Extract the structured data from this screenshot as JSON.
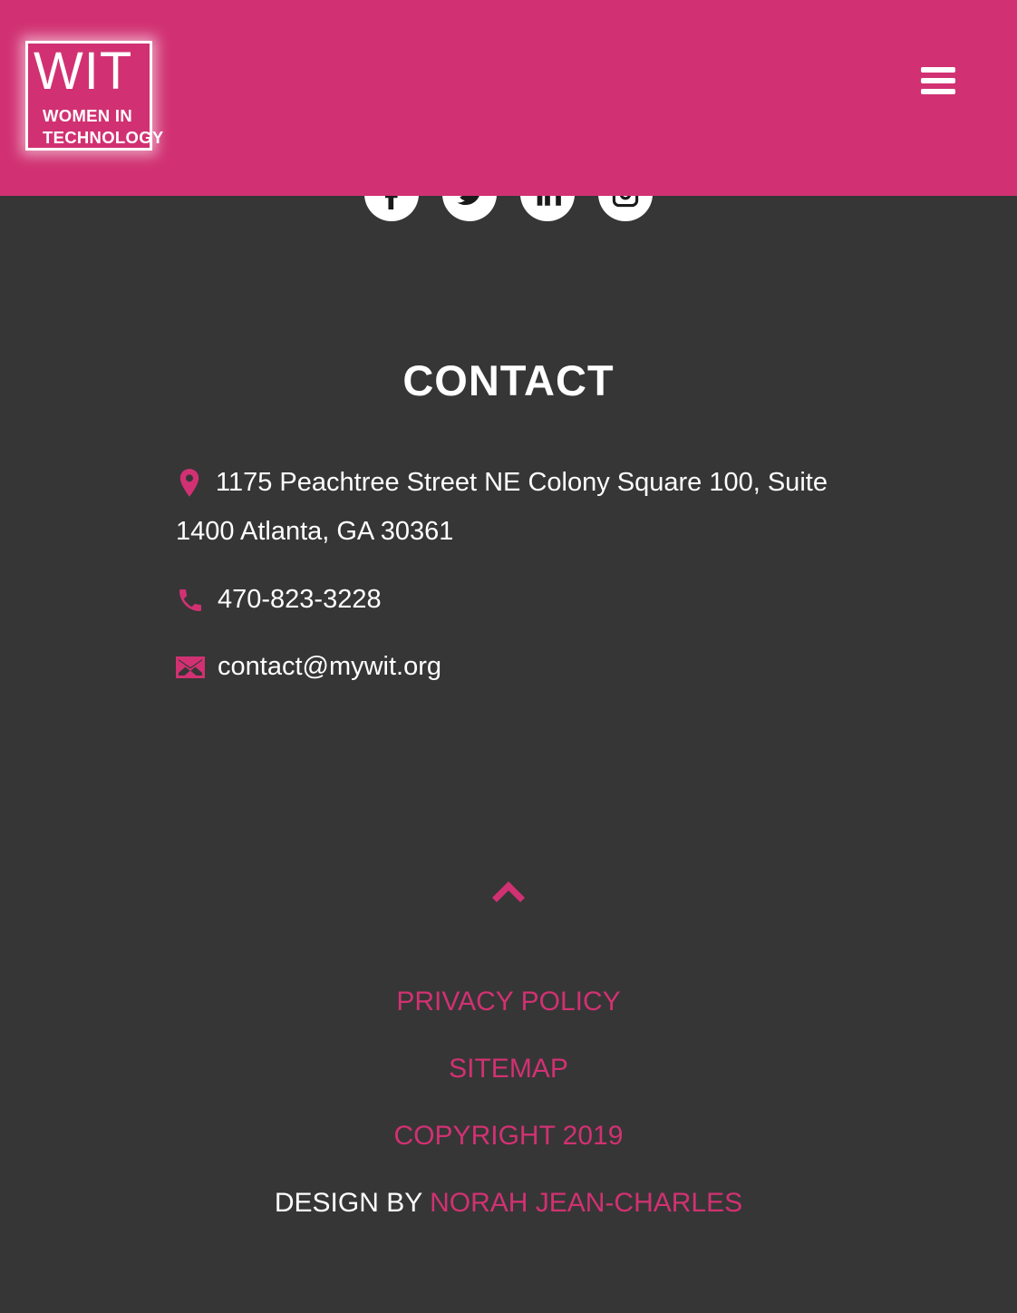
{
  "header": {
    "logo_big": "WIT",
    "logo_line1": "WOMEN IN",
    "logo_line2": "TECHNOLOGY",
    "menu_icon": "hamburger-menu-icon",
    "brand_color": "#d13172"
  },
  "social": [
    {
      "name": "facebook",
      "icon": "facebook-icon"
    },
    {
      "name": "twitter",
      "icon": "twitter-icon"
    },
    {
      "name": "linkedin",
      "icon": "linkedin-icon"
    },
    {
      "name": "instagram",
      "icon": "instagram-icon"
    }
  ],
  "contact": {
    "title": "CONTACT",
    "address_line1": "1175 Peachtree Street NE Colony Square 100, Suite",
    "address_line2": "1400 Atlanta, GA 30361",
    "phone": "470-823-3228",
    "email": "contact@mywit.org",
    "icons": {
      "address": "map-pin-icon",
      "phone": "phone-icon",
      "email": "envelope-icon"
    }
  },
  "footer": {
    "back_to_top_icon": "chevron-up-icon",
    "privacy": "PRIVACY POLICY",
    "sitemap": "SITEMAP",
    "copyright": "COPYRIGHT 2019",
    "design_by": "DESIGN BY",
    "designer": "NORAH JEAN-CHARLES"
  },
  "colors": {
    "background": "#363636",
    "accent": "#d13172",
    "text": "#ffffff"
  }
}
